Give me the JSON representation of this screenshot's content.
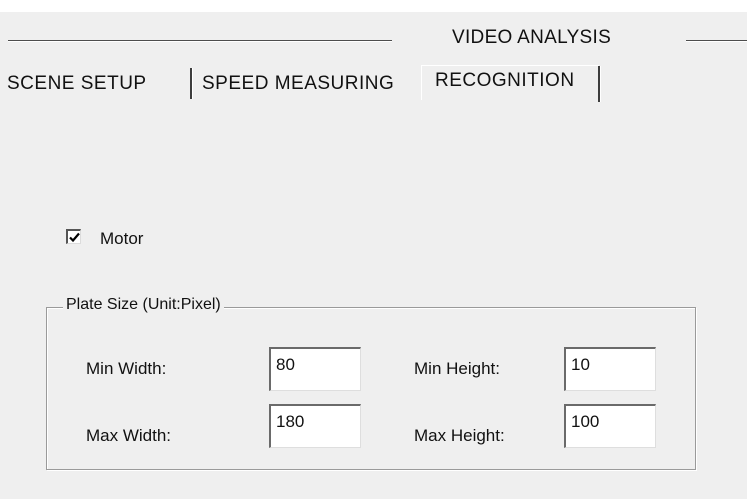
{
  "header": {
    "title": "VIDEO ANALYSIS"
  },
  "tabs": [
    {
      "label": "SCENE SETUP",
      "active": false
    },
    {
      "label": "SPEED MEASURING",
      "active": false
    },
    {
      "label": "RECOGNITION",
      "active": true
    }
  ],
  "recognition": {
    "motor": {
      "label": "Motor",
      "checked": true
    },
    "plate_size": {
      "legend": "Plate Size (Unit:Pixel)",
      "min_width": {
        "label": "Min Width:",
        "value": "80"
      },
      "max_width": {
        "label": "Max Width:",
        "value": "180"
      },
      "min_height": {
        "label": "Min Height:",
        "value": "10"
      },
      "max_height": {
        "label": "Max Height:",
        "value": "100"
      }
    }
  },
  "colors": {
    "panel_bg": "#efefef",
    "field_bg": "#ffffff",
    "text": "#111111"
  },
  "icons": {
    "checkbox_mark": "check-icon"
  }
}
